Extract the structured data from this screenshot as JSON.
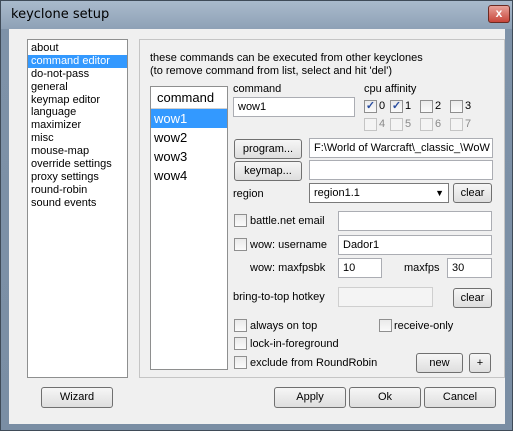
{
  "window": {
    "title": "keyclone setup",
    "close": "x"
  },
  "sidebar": {
    "items": [
      {
        "label": "about"
      },
      {
        "label": "command editor"
      },
      {
        "label": "do-not-pass"
      },
      {
        "label": "general"
      },
      {
        "label": "keymap editor"
      },
      {
        "label": "language"
      },
      {
        "label": "maximizer"
      },
      {
        "label": "misc"
      },
      {
        "label": "mouse-map"
      },
      {
        "label": "override settings"
      },
      {
        "label": "proxy settings"
      },
      {
        "label": "round-robin"
      },
      {
        "label": "sound events"
      }
    ],
    "selected": "command editor"
  },
  "panel": {
    "info_line1": "these commands can be executed from other keyclones",
    "info_line2": "(to remove command from list, select and hit 'del')"
  },
  "commands": {
    "header": "command",
    "items": [
      "wow1",
      "wow2",
      "wow3",
      "wow4"
    ],
    "selected": "wow1"
  },
  "command_field": {
    "label": "command",
    "value": "wow1"
  },
  "cpu_affinity": {
    "label": "cpu affinity",
    "cores": [
      {
        "label": "0",
        "checked": true,
        "enabled": true
      },
      {
        "label": "1",
        "checked": true,
        "enabled": true
      },
      {
        "label": "2",
        "checked": false,
        "enabled": true
      },
      {
        "label": "3",
        "checked": false,
        "enabled": true
      },
      {
        "label": "4",
        "checked": false,
        "enabled": false
      },
      {
        "label": "5",
        "checked": false,
        "enabled": false
      },
      {
        "label": "6",
        "checked": false,
        "enabled": false
      },
      {
        "label": "7",
        "checked": false,
        "enabled": false
      }
    ]
  },
  "program": {
    "button": "program...",
    "path": "F:\\World of Warcraft\\_classic_\\WoW"
  },
  "keymap": {
    "button": "keymap...",
    "value": ""
  },
  "region": {
    "label": "region",
    "value": "region1.1",
    "clear": "clear"
  },
  "battlenet": {
    "label": "battle.net email",
    "checked": false,
    "value": ""
  },
  "wow_username": {
    "label": "wow: username",
    "checked": false,
    "value": "Dador1"
  },
  "maxfpsbk": {
    "label": "wow: maxfpsbk",
    "value": "10"
  },
  "maxfps": {
    "label": "maxfps",
    "value": "30"
  },
  "hotkey": {
    "label": "bring-to-top hotkey",
    "value": "",
    "clear": "clear"
  },
  "options": {
    "always_on_top": "always on top",
    "receive_only": "receive-only",
    "lock_foreground": "lock-in-foreground",
    "exclude_rr": "exclude from RoundRobin"
  },
  "buttons": {
    "new": "new",
    "plus": "+",
    "wizard": "Wizard",
    "apply": "Apply",
    "ok": "Ok",
    "cancel": "Cancel"
  }
}
